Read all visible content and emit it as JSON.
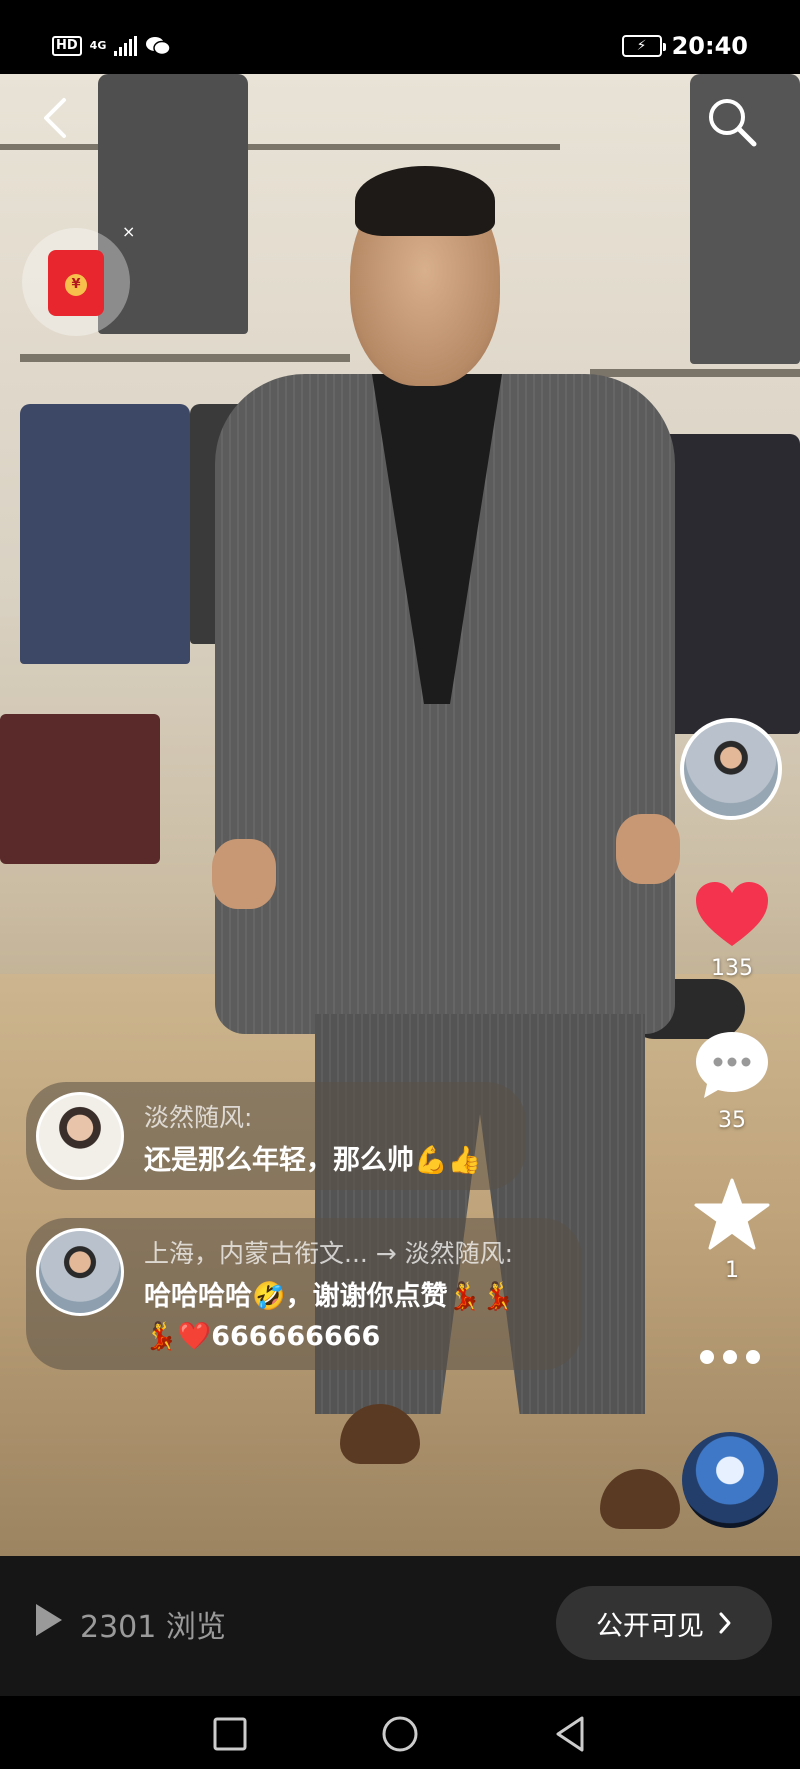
{
  "status_bar": {
    "hd": "HD",
    "network": "4G",
    "time": "20:40"
  },
  "video": {
    "actions": {
      "like_count": "135",
      "comment_count": "35",
      "favorite_count": "1"
    }
  },
  "comments": [
    {
      "author": "淡然随风:",
      "text": "还是那么年轻，那么帅💪👍"
    },
    {
      "author": "上海，内蒙古衔文...  → 淡然随风:",
      "text": "哈哈哈哈🤣，谢谢你点赞💃💃",
      "text2": "💃❤️666666666"
    }
  ],
  "bottom_bar": {
    "views": "2301 浏览",
    "visibility": "公开可见"
  },
  "colors": {
    "like": "#f4344f",
    "bar_bg": "#161616",
    "pill_bg": "#333333"
  }
}
